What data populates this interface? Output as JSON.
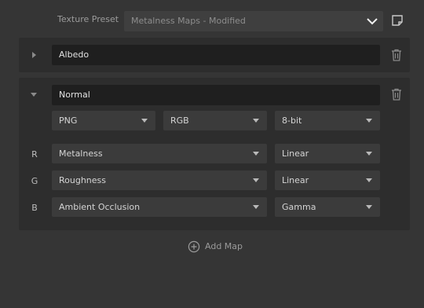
{
  "preset": {
    "label": "Texture Preset",
    "value": "Metalness Maps - Modified",
    "save_icon": "save-preset-icon"
  },
  "maps": [
    {
      "name": "Albedo",
      "expanded": false,
      "expand_icon": "chevron-right-icon",
      "delete_icon": "trash-icon"
    },
    {
      "name": "Normal",
      "expanded": true,
      "expand_icon": "chevron-down-icon",
      "delete_icon": "trash-icon",
      "format": "PNG",
      "color_space": "RGB",
      "bit_depth": "8-bit",
      "channels": [
        {
          "channel": "R",
          "source": "Metalness",
          "encoding": "Linear"
        },
        {
          "channel": "G",
          "source": "Roughness",
          "encoding": "Linear"
        },
        {
          "channel": "B",
          "source": "Ambient Occlusion",
          "encoding": "Gamma"
        }
      ]
    }
  ],
  "add_map": {
    "label": "Add Map",
    "icon": "plus-circle-icon"
  },
  "colors": {
    "background": "#353535",
    "panel": "#2d2d2d",
    "field": "#1f1f1f",
    "dropdown": "#3b3b3b"
  }
}
